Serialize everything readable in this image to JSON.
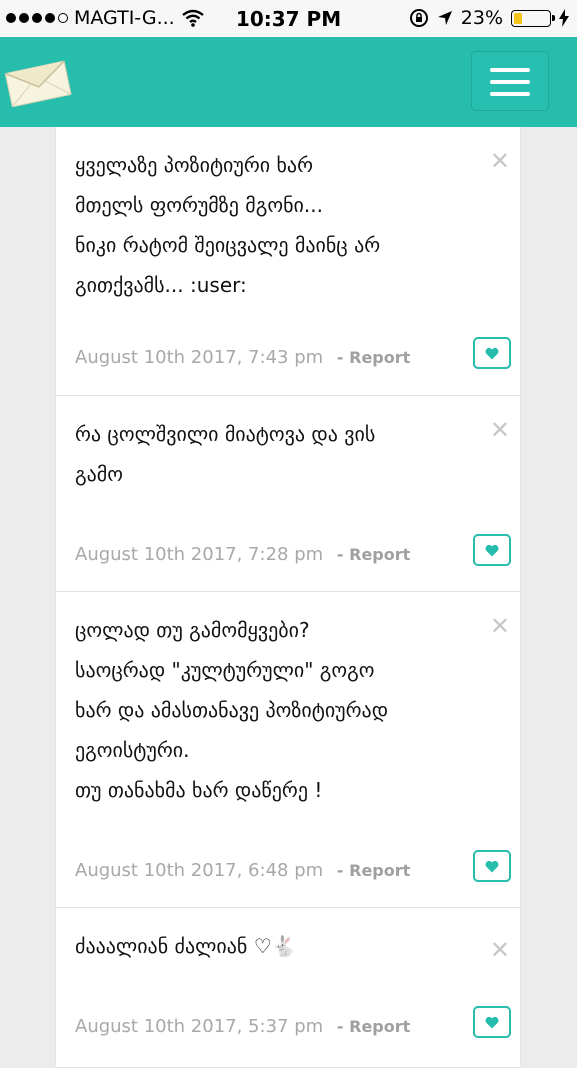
{
  "status_bar": {
    "carrier": "MAGTI-G...",
    "time": "10:37 PM",
    "battery": "23%",
    "battery_level": 0.23
  },
  "header": {
    "logo_icon": "envelope-icon",
    "menu_icon": "hamburger-menu-icon"
  },
  "colors": {
    "accent": "#26bdad",
    "battery": "#f3c21b"
  },
  "posts": [
    {
      "text": "ყველაზე პოზიტიური ხარ\nმთელს ფორუმზე მგონი...\nნიკი რატომ შეიცვალე მაინც არ\nგითქვამს... :user:",
      "date": "August 10th 2017, 7:43 pm",
      "report": "- Report"
    },
    {
      "text": "რა ცოლშვილი მიატოვა და ვის\nგამო",
      "date": "August 10th 2017, 7:28 pm",
      "report": "- Report"
    },
    {
      "text": "ცოლად თუ გამომყვები?\nსაოცრად \"კულტურული\" გოგო\nხარ და ამასთანავე პოზიტიურად\nეგოისტური.\nთუ თანახმა ხარ დაწერე !",
      "date": "August 10th 2017, 6:48 pm",
      "report": "- Report"
    },
    {
      "text": "ძააალიან ძალიან ♡🐇",
      "date": "August 10th 2017, 5:37 pm",
      "report": "- Report"
    }
  ]
}
